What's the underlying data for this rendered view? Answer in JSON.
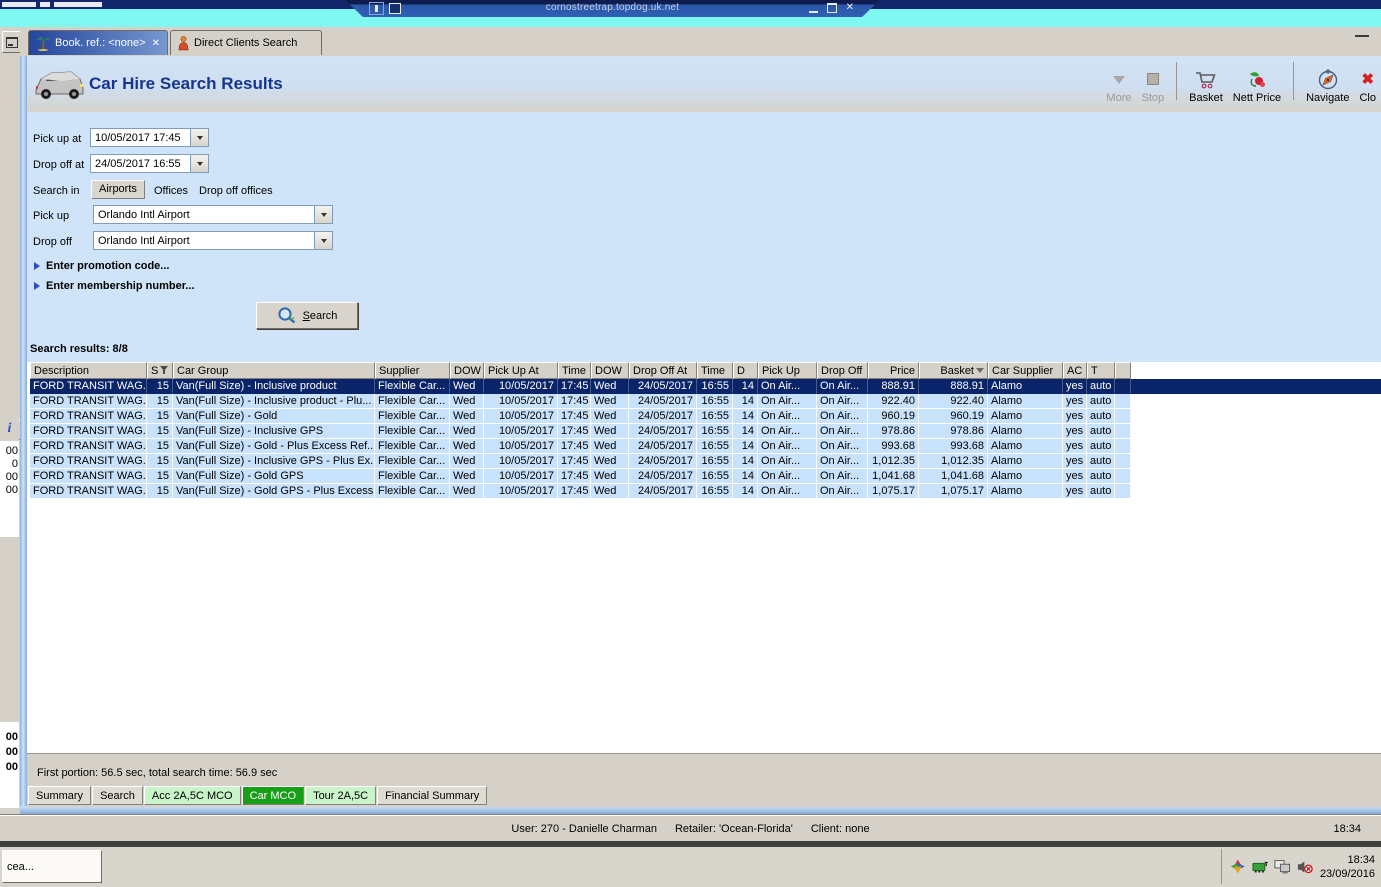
{
  "colors": {
    "selection_navy": "#0a246a",
    "row_blue": "#c9e2fb",
    "cyan_strip": "#7ef8f0",
    "title_navy": "#13266a",
    "rdp_blue": "#2b57a8",
    "tab_green_dark": "#17a017",
    "tab_green_light": "#c9f3c9",
    "header_title": "#16368c"
  },
  "rdp_bar": {
    "title": "cornostreetrap.topdog.uk.net"
  },
  "window_tabs": {
    "tab1": {
      "label": "Book. ref.: <none>",
      "close": "✕"
    },
    "tab2": {
      "label": "Direct Clients Search"
    }
  },
  "header": {
    "title": "Car Hire Search Results"
  },
  "toolbar": {
    "items": [
      {
        "label": "More",
        "disabled": true
      },
      {
        "label": "Stop",
        "disabled": true
      },
      {
        "label": "Basket",
        "disabled": false
      },
      {
        "label": "Nett Price",
        "disabled": false
      },
      {
        "label": "Navigate",
        "disabled": false
      },
      {
        "label": "Clo",
        "disabled": false
      }
    ]
  },
  "form": {
    "pickup_at_label": "Pick up at",
    "pickup_at_value": "10/05/2017 17:45",
    "dropoff_at_label": "Drop off at",
    "dropoff_at_value": "24/05/2017 16:55",
    "search_in_label": "Search in",
    "search_in_options": [
      "Airports",
      "Offices",
      "Drop off offices"
    ],
    "search_in_selected": "Airports",
    "pickup_label": "Pick up",
    "pickup_value": "Orlando Intl Airport",
    "dropoff_label": "Drop off",
    "dropoff_value": "Orlando Intl Airport",
    "promo_label": "Enter promotion code...",
    "membership_label": "Enter membership number...",
    "search_button_first": "S",
    "search_button_rest": "earch"
  },
  "results": {
    "summary": "Search results: 8/8",
    "selected_index": 0,
    "columns": [
      {
        "label": "Description"
      },
      {
        "label": "S",
        "icon": "filter"
      },
      {
        "label": "Car Group"
      },
      {
        "label": "Supplier"
      },
      {
        "label": "DOW"
      },
      {
        "label": "Pick Up At"
      },
      {
        "label": "Time"
      },
      {
        "label": "DOW"
      },
      {
        "label": "Drop Off At"
      },
      {
        "label": "Time"
      },
      {
        "label": "D"
      },
      {
        "label": "Pick Up"
      },
      {
        "label": "Drop Off"
      },
      {
        "label": "Price"
      },
      {
        "label": "Basket",
        "icon": "sort"
      },
      {
        "label": "Car Supplier"
      },
      {
        "label": "AC"
      },
      {
        "label": "T"
      }
    ],
    "rows": [
      [
        "FORD TRANSIT WAG...",
        "15",
        "Van(Full Size) - Inclusive product",
        "Flexible Car...",
        "Wed",
        "10/05/2017",
        "17:45",
        "Wed",
        "24/05/2017",
        "16:55",
        "14",
        "On Air...",
        "On Air...",
        "888.91",
        "888.91",
        "Alamo",
        "yes",
        "auto"
      ],
      [
        "FORD TRANSIT WAG...",
        "15",
        "Van(Full Size) - Inclusive product - Plu...",
        "Flexible Car...",
        "Wed",
        "10/05/2017",
        "17:45",
        "Wed",
        "24/05/2017",
        "16:55",
        "14",
        "On Air...",
        "On Air...",
        "922.40",
        "922.40",
        "Alamo",
        "yes",
        "auto"
      ],
      [
        "FORD TRANSIT WAG...",
        "15",
        "Van(Full Size) - Gold",
        "Flexible Car...",
        "Wed",
        "10/05/2017",
        "17:45",
        "Wed",
        "24/05/2017",
        "16:55",
        "14",
        "On Air...",
        "On Air...",
        "960.19",
        "960.19",
        "Alamo",
        "yes",
        "auto"
      ],
      [
        "FORD TRANSIT WAG...",
        "15",
        "Van(Full Size) - Inclusive GPS",
        "Flexible Car...",
        "Wed",
        "10/05/2017",
        "17:45",
        "Wed",
        "24/05/2017",
        "16:55",
        "14",
        "On Air...",
        "On Air...",
        "978.86",
        "978.86",
        "Alamo",
        "yes",
        "auto"
      ],
      [
        "FORD TRANSIT WAG...",
        "15",
        "Van(Full Size) - Gold - Plus Excess Ref...",
        "Flexible Car...",
        "Wed",
        "10/05/2017",
        "17:45",
        "Wed",
        "24/05/2017",
        "16:55",
        "14",
        "On Air...",
        "On Air...",
        "993.68",
        "993.68",
        "Alamo",
        "yes",
        "auto"
      ],
      [
        "FORD TRANSIT WAG...",
        "15",
        "Van(Full Size) - Inclusive GPS - Plus Ex...",
        "Flexible Car...",
        "Wed",
        "10/05/2017",
        "17:45",
        "Wed",
        "24/05/2017",
        "16:55",
        "14",
        "On Air...",
        "On Air...",
        "1,012.35",
        "1,012.35",
        "Alamo",
        "yes",
        "auto"
      ],
      [
        "FORD TRANSIT WAG...",
        "15",
        "Van(Full Size) - Gold GPS",
        "Flexible Car...",
        "Wed",
        "10/05/2017",
        "17:45",
        "Wed",
        "24/05/2017",
        "16:55",
        "14",
        "On Air...",
        "On Air...",
        "1,041.68",
        "1,041.68",
        "Alamo",
        "yes",
        "auto"
      ],
      [
        "FORD TRANSIT WAG...",
        "15",
        "Van(Full Size) - Gold GPS - Plus Excess...",
        "Flexible Car...",
        "Wed",
        "10/05/2017",
        "17:45",
        "Wed",
        "24/05/2017",
        "16:55",
        "14",
        "On Air...",
        "On Air...",
        "1,075.17",
        "1,075.17",
        "Alamo",
        "yes",
        "auto"
      ]
    ]
  },
  "status": {
    "timing": "First portion: 56.5 sec, total search time: 56.9 sec"
  },
  "bottom_tabs": {
    "items": [
      {
        "label": "Summary",
        "style": "plain"
      },
      {
        "label": "Search",
        "style": "plain"
      },
      {
        "label": "Acc 2A,5C MCO",
        "style": "g-light"
      },
      {
        "label": "Car MCO",
        "style": "g-dark"
      },
      {
        "label": "Tour 2A,5C",
        "style": "g-light"
      },
      {
        "label": "Financial Summary",
        "style": "plain"
      }
    ]
  },
  "user_bar": {
    "user": "User: 270 - Danielle Charman",
    "retailer": "Retailer: 'Ocean-Florida'",
    "client": "Client: none",
    "time": "18:34"
  },
  "taskbar": {
    "app_button": "cea...",
    "tray_time": "18:34",
    "tray_date": "23/09/2016"
  },
  "left_panel": {
    "info": "i",
    "mid_values": [
      "00",
      "0",
      "00",
      "00"
    ],
    "bottom_values": [
      "00",
      "00",
      "00"
    ]
  }
}
